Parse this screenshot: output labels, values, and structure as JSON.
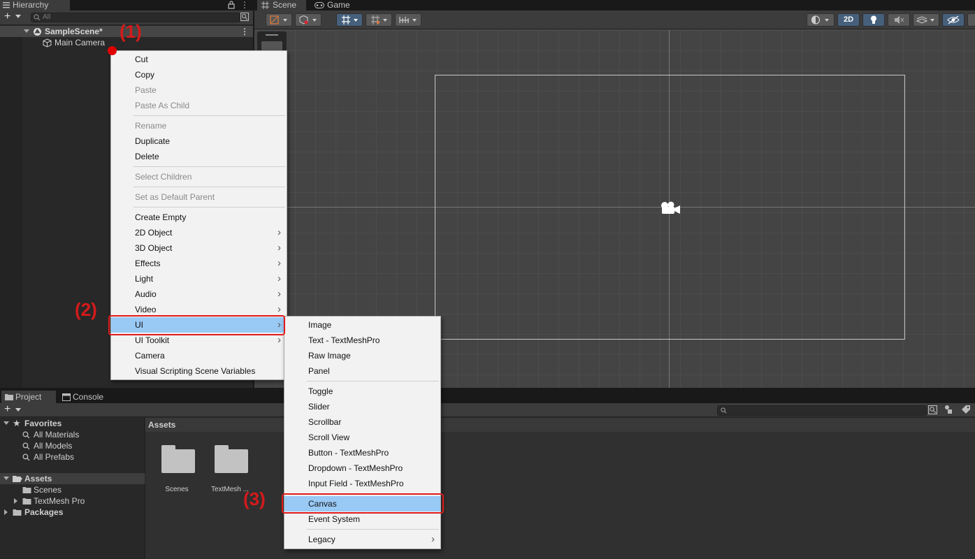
{
  "hierarchy": {
    "tab_label": "Hierarchy",
    "add_label": "+",
    "search_placeholder": "All",
    "scene_name": "SampleScene*",
    "camera_name": "Main Camera"
  },
  "scene_tabs": {
    "scene_label": "Scene",
    "game_label": "Game"
  },
  "scene_toolbar": {
    "mode_2d_label": "2D"
  },
  "project": {
    "tab_project": "Project",
    "tab_console": "Console",
    "add_label": "+",
    "tree": {
      "favorites": "Favorites",
      "all_materials": "All Materials",
      "all_models": "All Models",
      "all_prefabs": "All Prefabs",
      "assets": "Assets",
      "scenes": "Scenes",
      "textmesh_pro": "TextMesh Pro",
      "packages": "Packages"
    },
    "assets_header": "Assets",
    "folders": [
      {
        "label": "Scenes"
      },
      {
        "label": "TextMesh ..."
      }
    ]
  },
  "context_menu": {
    "items": [
      {
        "label": "Cut",
        "disabled": false,
        "submenu": false
      },
      {
        "label": "Copy",
        "disabled": false,
        "submenu": false
      },
      {
        "label": "Paste",
        "disabled": true,
        "submenu": false
      },
      {
        "label": "Paste As Child",
        "disabled": true,
        "submenu": false
      },
      {
        "label": "Rename",
        "disabled": true,
        "submenu": false
      },
      {
        "label": "Duplicate",
        "disabled": false,
        "submenu": false
      },
      {
        "label": "Delete",
        "disabled": false,
        "submenu": false
      },
      {
        "label": "Select Children",
        "disabled": true,
        "submenu": false
      },
      {
        "label": "Set as Default Parent",
        "disabled": true,
        "submenu": false
      },
      {
        "label": "Create Empty",
        "disabled": false,
        "submenu": false
      },
      {
        "label": "2D Object",
        "disabled": false,
        "submenu": true
      },
      {
        "label": "3D Object",
        "disabled": false,
        "submenu": true
      },
      {
        "label": "Effects",
        "disabled": false,
        "submenu": true
      },
      {
        "label": "Light",
        "disabled": false,
        "submenu": true
      },
      {
        "label": "Audio",
        "disabled": false,
        "submenu": true
      },
      {
        "label": "Video",
        "disabled": false,
        "submenu": true
      },
      {
        "label": "UI",
        "disabled": false,
        "submenu": true,
        "selected": true
      },
      {
        "label": "UI Toolkit",
        "disabled": false,
        "submenu": true
      },
      {
        "label": "Camera",
        "disabled": false,
        "submenu": false
      },
      {
        "label": "Visual Scripting Scene Variables",
        "disabled": false,
        "submenu": false
      }
    ]
  },
  "ui_submenu": {
    "items": [
      {
        "label": "Image"
      },
      {
        "label": "Text - TextMeshPro"
      },
      {
        "label": "Raw Image"
      },
      {
        "label": "Panel"
      },
      {
        "label": "Toggle"
      },
      {
        "label": "Slider"
      },
      {
        "label": "Scrollbar"
      },
      {
        "label": "Scroll View"
      },
      {
        "label": "Button - TextMeshPro"
      },
      {
        "label": "Dropdown - TextMeshPro"
      },
      {
        "label": "Input Field - TextMeshPro"
      },
      {
        "label": "Canvas",
        "selected": true
      },
      {
        "label": "Event System"
      },
      {
        "label": "Legacy",
        "submenu": true
      }
    ]
  },
  "annotations": {
    "step1": "(1)",
    "step2": "(2)",
    "step3": "(3)"
  },
  "colors": {
    "highlight": "#99c9f5",
    "annotation_red": "#e01b1b",
    "accent_blue": "#46607c"
  }
}
